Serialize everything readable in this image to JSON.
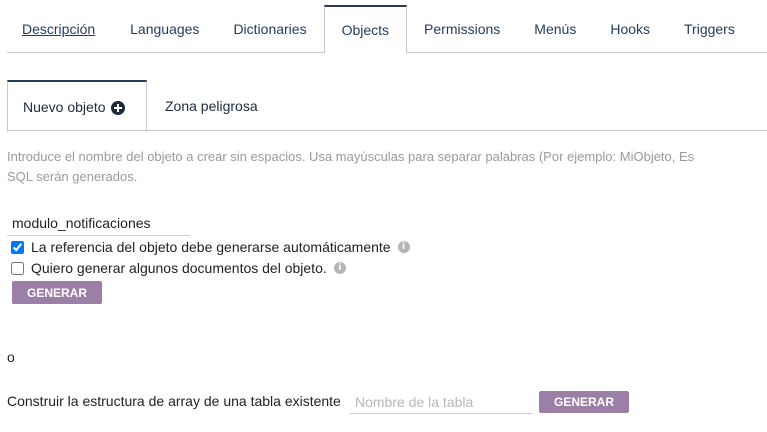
{
  "top_tabs": [
    {
      "label": "Descripción",
      "active": false
    },
    {
      "label": "Languages",
      "active": false
    },
    {
      "label": "Dictionaries",
      "active": false
    },
    {
      "label": "Objects",
      "active": true
    },
    {
      "label": "Permissions",
      "active": false
    },
    {
      "label": "Menús",
      "active": false
    },
    {
      "label": "Hooks",
      "active": false
    },
    {
      "label": "Triggers",
      "active": false
    }
  ],
  "sub_tabs": [
    {
      "label": "Nuevo objeto",
      "icon": "plus-circle-icon",
      "active": true
    },
    {
      "label": "Zona peligrosa",
      "active": false
    }
  ],
  "new_object": {
    "help_line1": "Introduce el nombre del objeto a crear sin espacios. Usa mayúsculas para separar palabras (Por ejemplo: MiObjeto, Es",
    "help_line2": "SQL serán generados.",
    "name_value": "modulo_notificaciones",
    "auto_ref_label": "La referencia del objeto debe generarse automáticamente",
    "auto_ref_checked": true,
    "gen_docs_label": "Quiero generar algunos documentos del objeto.",
    "gen_docs_checked": false,
    "generate_button": "GENERAR"
  },
  "or_text": "o",
  "build_from_table": {
    "label": "Construir la estructura de array de una tabla existente",
    "table_placeholder": "Nombre de la tabla",
    "generate_button": "GENERAR"
  },
  "colors": {
    "tab_text": "#263c5c",
    "button": "#9c7fa6",
    "help_text": "#9a9a9a"
  }
}
